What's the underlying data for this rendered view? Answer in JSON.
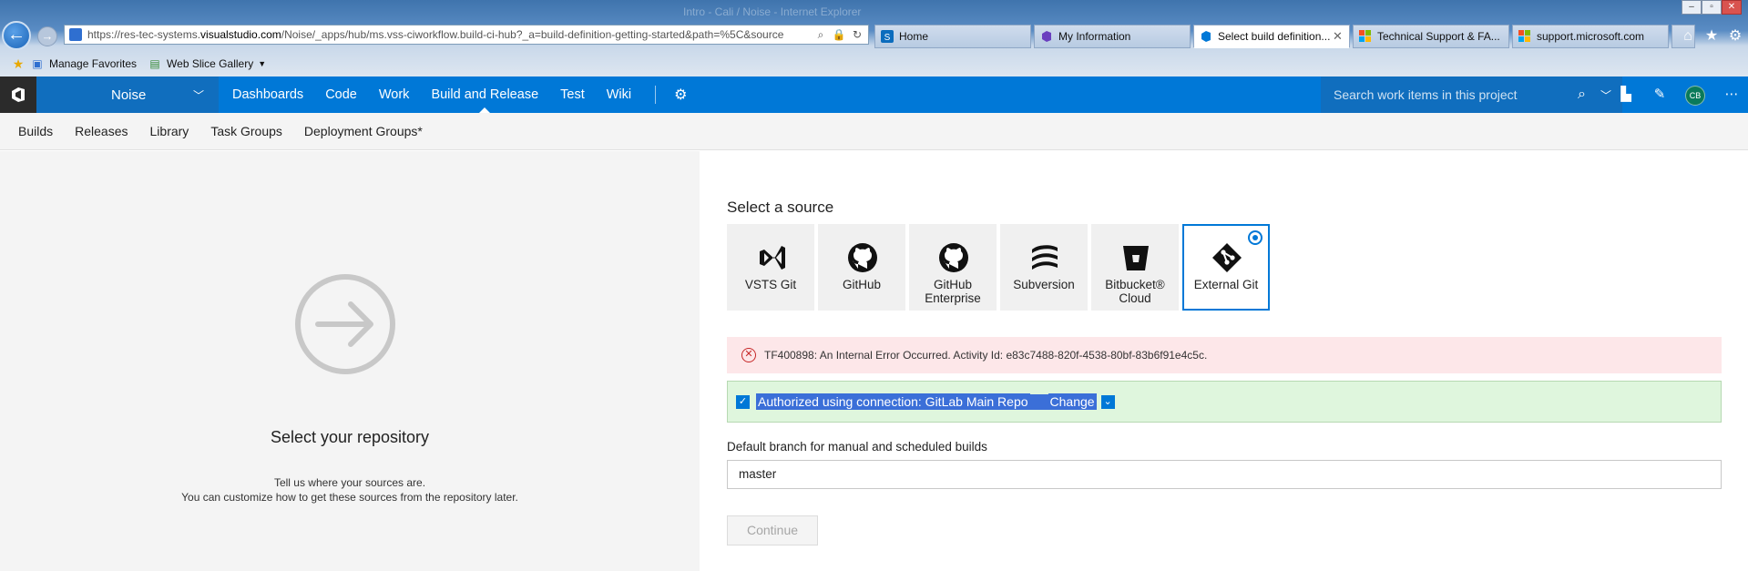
{
  "browser": {
    "window_title": "Intro - Cali / Noise - Internet Explorer",
    "url_prefix": "https://res-tec-systems.",
    "url_domain": "visualstudio.com",
    "url_path": "/Noise/_apps/hub/ms.vss-ciworkflow.build-ci-hub?_a=build-definition-getting-started&path=%5C&source",
    "tabs": [
      {
        "title": "Home",
        "active": false
      },
      {
        "title": "My Information",
        "active": false
      },
      {
        "title": "Select build definition...",
        "active": true
      },
      {
        "title": "Technical Support & FA...",
        "active": false
      },
      {
        "title": "support.microsoft.com",
        "active": false
      }
    ],
    "favorites": [
      {
        "label": "Manage Favorites"
      },
      {
        "label": "Web Slice Gallery"
      }
    ]
  },
  "topnav": {
    "project": "Noise",
    "hubs": [
      "Dashboards",
      "Code",
      "Work",
      "Build and Release",
      "Test",
      "Wiki"
    ],
    "selected_hub": "Build and Release",
    "search_placeholder": "Search work items in this project",
    "avatar_initials": "CB"
  },
  "subnav": {
    "items": [
      "Builds",
      "Releases",
      "Library",
      "Task Groups",
      "Deployment Groups*"
    ]
  },
  "left": {
    "title": "Select your repository",
    "desc_line1": "Tell us where your sources are.",
    "desc_line2": "You can customize how to get these sources from the repository later."
  },
  "right": {
    "heading": "Select a source",
    "sources": [
      {
        "label": "VSTS Git",
        "icon": "vsts-icon",
        "selected": false
      },
      {
        "label": "GitHub",
        "icon": "github-icon",
        "selected": false
      },
      {
        "label": "GitHub Enterprise",
        "icon": "github-icon",
        "selected": false
      },
      {
        "label": "Subversion",
        "icon": "subversion-icon",
        "selected": false
      },
      {
        "label": "Bitbucket® Cloud",
        "icon": "bitbucket-icon",
        "selected": false
      },
      {
        "label": "External Git",
        "icon": "git-icon",
        "selected": true
      }
    ],
    "error": "TF400898: An Internal Error Occurred. Activity Id: e83c7488-820f-4538-80bf-83b6f91e4c5c.",
    "auth_text": "Authorized using connection: GitLab Main Repo",
    "auth_change": "Change",
    "branch_label": "Default branch for manual and scheduled builds",
    "branch_value": "master",
    "continue_label": "Continue"
  },
  "colors": {
    "accent": "#0078d7",
    "error_bg": "#fde7e9",
    "success_bg": "#dff6dd"
  }
}
